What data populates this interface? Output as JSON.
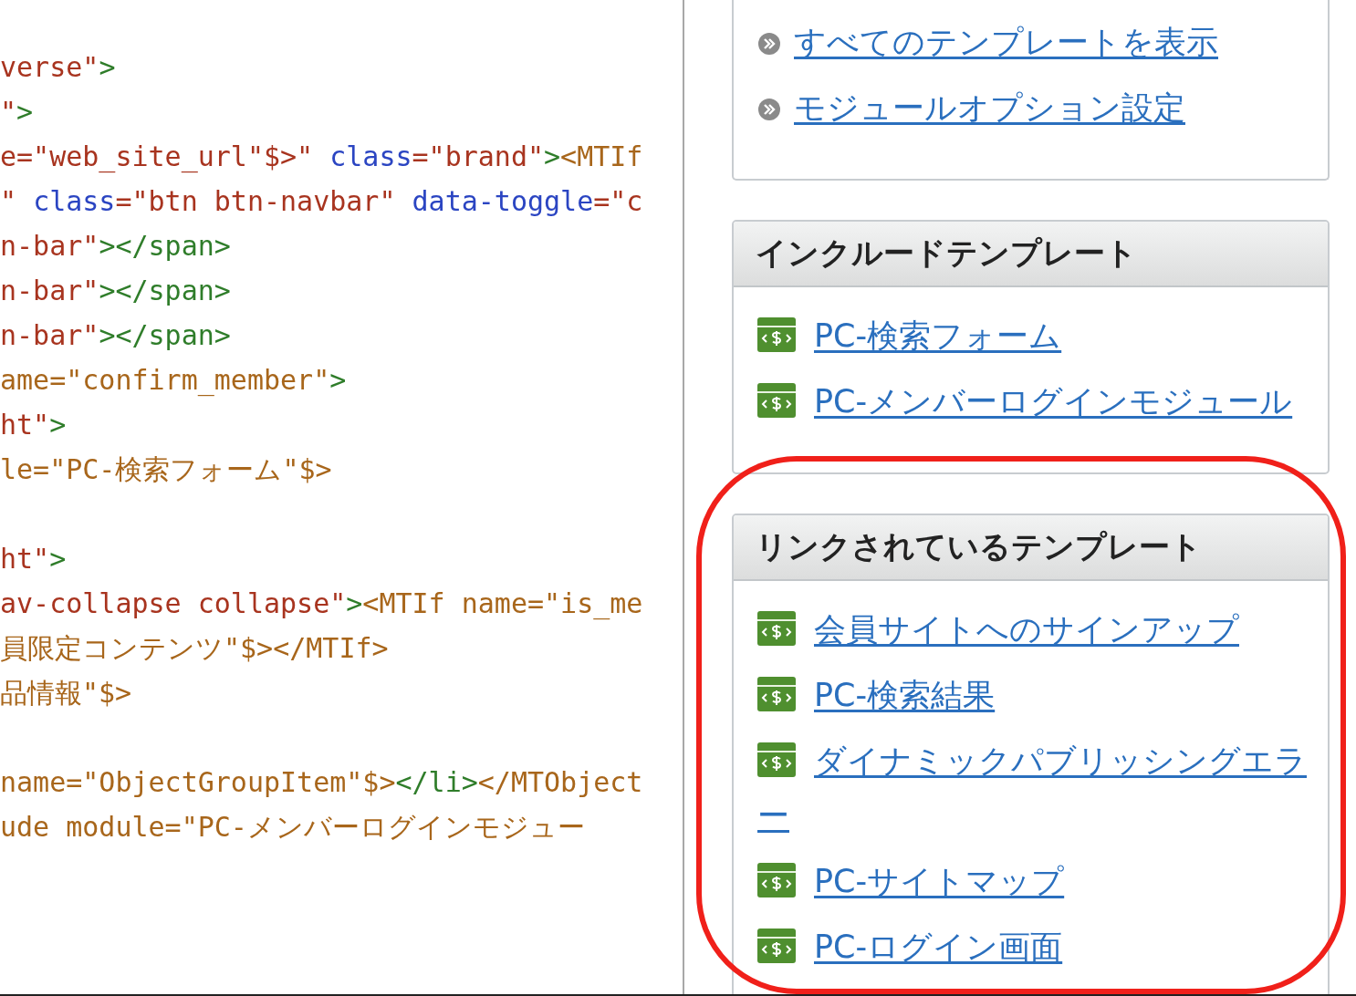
{
  "code_lines": [
    {
      "segments": [
        {
          "kind": "value",
          "text": "verse\""
        },
        {
          "kind": "tag",
          "text": ">"
        }
      ]
    },
    {
      "segments": [
        {
          "kind": "value",
          "text": "\""
        },
        {
          "kind": "tag",
          "text": ">"
        }
      ]
    },
    {
      "segments": [
        {
          "kind": "value",
          "text": "e=\"web_site_url\"$>\" "
        },
        {
          "kind": "attr",
          "text": "class"
        },
        {
          "kind": "value",
          "text": "=\"brand\""
        },
        {
          "kind": "tag",
          "text": ">"
        },
        {
          "kind": "mt",
          "text": "<MTIf"
        }
      ]
    },
    {
      "segments": [
        {
          "kind": "value",
          "text": "\" "
        },
        {
          "kind": "attr",
          "text": "class"
        },
        {
          "kind": "value",
          "text": "=\"btn btn-navbar\" "
        },
        {
          "kind": "attr",
          "text": "data-toggle"
        },
        {
          "kind": "value",
          "text": "=\"c"
        }
      ]
    },
    {
      "segments": [
        {
          "kind": "value",
          "text": "n-bar\""
        },
        {
          "kind": "tag",
          "text": "></span>"
        }
      ]
    },
    {
      "segments": [
        {
          "kind": "value",
          "text": "n-bar\""
        },
        {
          "kind": "tag",
          "text": "></span>"
        }
      ]
    },
    {
      "segments": [
        {
          "kind": "value",
          "text": "n-bar\""
        },
        {
          "kind": "tag",
          "text": "></span>"
        }
      ]
    },
    {
      "segments": [
        {
          "kind": "mt",
          "text": "ame=\"confirm_member\""
        },
        {
          "kind": "tag",
          "text": ">"
        }
      ]
    },
    {
      "segments": [
        {
          "kind": "value",
          "text": "ht\""
        },
        {
          "kind": "tag",
          "text": ">"
        }
      ]
    },
    {
      "segments": [
        {
          "kind": "mt",
          "text": "le=\"PC-検索フォーム\"$>"
        }
      ]
    },
    {
      "kind": "blank"
    },
    {
      "segments": [
        {
          "kind": "value",
          "text": "ht\""
        },
        {
          "kind": "tag",
          "text": ">"
        }
      ]
    },
    {
      "segments": [
        {
          "kind": "value",
          "text": "av-collapse collapse\""
        },
        {
          "kind": "tag",
          "text": ">"
        },
        {
          "kind": "mt",
          "text": "<MTIf name=\"is_me"
        }
      ]
    },
    {
      "segments": [
        {
          "kind": "mt",
          "text": "員限定コンテンツ\"$></MTIf>"
        }
      ]
    },
    {
      "segments": [
        {
          "kind": "mt",
          "text": "品情報\"$>"
        }
      ]
    },
    {
      "kind": "blank"
    },
    {
      "segments": [
        {
          "kind": "mt",
          "text": "name=\"ObjectGroupItem\"$>"
        },
        {
          "kind": "tag",
          "text": "</li>"
        },
        {
          "kind": "mt",
          "text": "</MTObject"
        }
      ]
    },
    {
      "segments": [
        {
          "kind": "mt",
          "text": "ude module=\"PC-メンバーログインモジュー"
        }
      ]
    }
  ],
  "panels": [
    {
      "items": [
        {
          "kind": "action",
          "text": "すべてのテンプレートを表示"
        },
        {
          "kind": "action",
          "text": "モジュールオプション設定"
        }
      ]
    },
    {
      "title": "インクルードテンプレート",
      "items": [
        {
          "kind": "template",
          "text": "PC-検索フォーム"
        },
        {
          "kind": "template",
          "text": "PC-メンバーログインモジュール"
        }
      ]
    },
    {
      "title": "リンクされているテンプレート",
      "items": [
        {
          "kind": "template",
          "text": "会員サイトへのサインアップ"
        },
        {
          "kind": "template",
          "text": "PC-検索結果"
        },
        {
          "kind": "template",
          "text": "ダイナミックパブリッシングエラー"
        },
        {
          "kind": "template",
          "text": "PC-サイトマップ"
        },
        {
          "kind": "template",
          "text": "PC-ログイン画面"
        }
      ]
    }
  ]
}
